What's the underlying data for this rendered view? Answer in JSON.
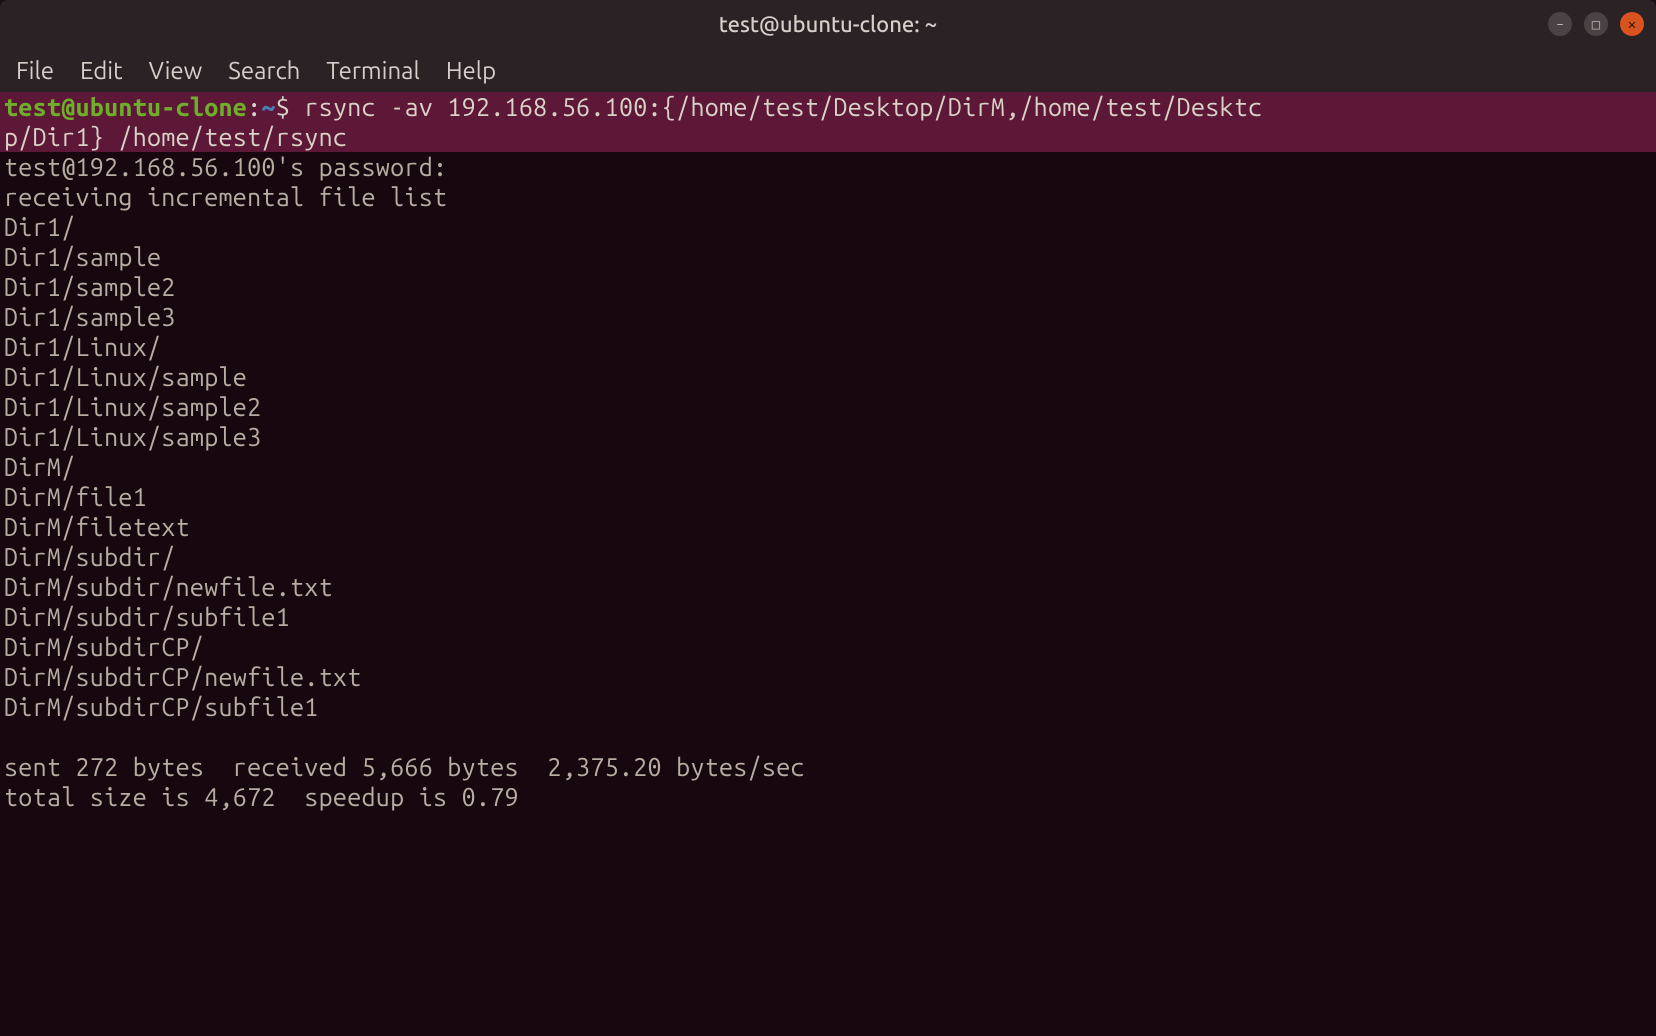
{
  "titlebar": {
    "title": "test@ubuntu-clone: ~"
  },
  "menubar": {
    "file": "File",
    "edit": "Edit",
    "view": "View",
    "search": "Search",
    "terminal": "Terminal",
    "help": "Help"
  },
  "prompt": {
    "user_host": "test@ubuntu-clone",
    "sep1": ":",
    "path": "~",
    "sep2": "$ ",
    "cmd_line1": "rsync -av 192.168.56.100:{/home/test/Desktop/DirM,/home/test/Desktc",
    "cmd_line2": "p/Dir1} /home/test/rsync"
  },
  "output": {
    "pw": "test@192.168.56.100's password:",
    "recv": "receiving incremental file list",
    "l1": "Dir1/",
    "l2": "Dir1/sample",
    "l3": "Dir1/sample2",
    "l4": "Dir1/sample3",
    "l5": "Dir1/Linux/",
    "l6": "Dir1/Linux/sample",
    "l7": "Dir1/Linux/sample2",
    "l8": "Dir1/Linux/sample3",
    "l9": "DirM/",
    "l10": "DirM/file1",
    "l11": "DirM/filetext",
    "l12": "DirM/subdir/",
    "l13": "DirM/subdir/newfile.txt",
    "l14": "DirM/subdir/subfile1",
    "l15": "DirM/subdirCP/",
    "l16": "DirM/subdirCP/newfile.txt",
    "l17": "DirM/subdirCP/subfile1",
    "sent": "sent 272 bytes  received 5,666 bytes  2,375.20 bytes/sec",
    "total": "total size is 4,672  speedup is 0.79"
  },
  "icons": {
    "min": "–",
    "max": "□",
    "close": "✕"
  }
}
